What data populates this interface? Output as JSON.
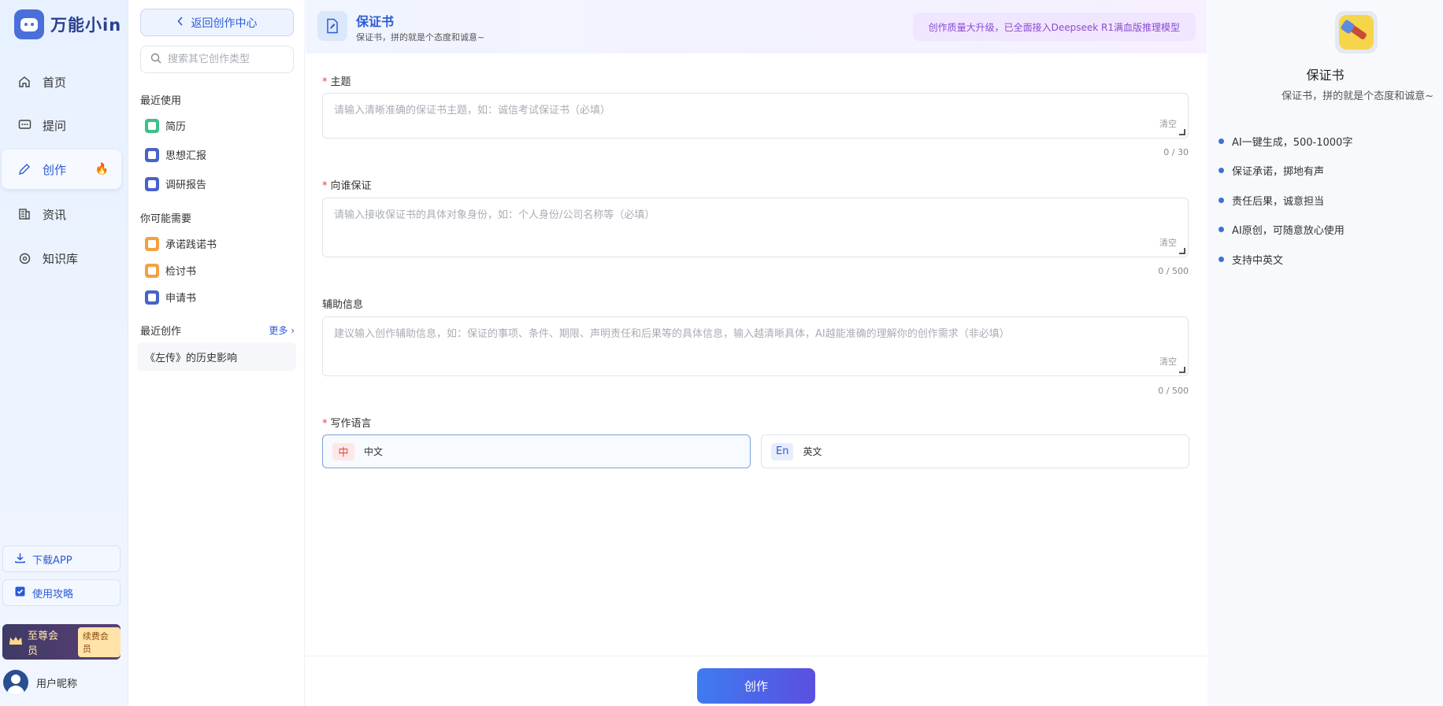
{
  "nav": {
    "brand": "万能小in",
    "items": [
      {
        "label": "首页",
        "icon": "home-icon"
      },
      {
        "label": "提问",
        "icon": "chat-icon"
      },
      {
        "label": "创作",
        "icon": "pen-icon",
        "badge": "fire-icon"
      },
      {
        "label": "资讯",
        "icon": "news-icon"
      },
      {
        "label": "知识库",
        "icon": "brain-icon"
      }
    ],
    "download": "下载APP",
    "guide": "使用攻略",
    "vip_label": "至尊会员",
    "vip_action": "续费会员",
    "user_name": "用户昵称"
  },
  "panel": {
    "back": "返回创作中心",
    "search_placeholder": "搜索其它创作类型",
    "recent_used_title": "最近使用",
    "recent_used": [
      "简历",
      "思想汇报",
      "调研报告"
    ],
    "maybe_title": "你可能需要",
    "maybe": [
      "承诺践诺书",
      "检讨书",
      "申请书"
    ],
    "recent_created_title": "最近创作",
    "more": "更多",
    "recent_created": [
      "《左传》的历史影响"
    ]
  },
  "header": {
    "title": "保证书",
    "subtitle": "保证书，拼的就是个态度和诚意~",
    "promo": "创作质量大升级，已全面接入Deepseek R1满血版推理模型"
  },
  "form": {
    "topic": {
      "label": "主题",
      "placeholder": "请输入清晰准确的保证书主题，如：诚信考试保证书（必填）",
      "clear": "清空",
      "count": "0 / 30"
    },
    "to_whom": {
      "label": "向谁保证",
      "placeholder": "请输入接收保证书的具体对象身份，如：个人身份/公司名称等（必填）",
      "clear": "清空",
      "count": "0 / 500"
    },
    "extra": {
      "label": "辅助信息",
      "placeholder": "建议输入创作辅助信息，如：保证的事项、条件、期限、声明责任和后果等的具体信息，输入越清晰具体，AI越能准确的理解你的创作需求（非必填）",
      "clear": "清空",
      "count": "0 / 500"
    },
    "language": {
      "label": "写作语言",
      "options": [
        {
          "tag": "中",
          "label": "中文",
          "selected": true
        },
        {
          "tag": "En",
          "label": "英文",
          "selected": false
        }
      ]
    },
    "submit": "创作"
  },
  "right": {
    "title": "保证书",
    "subtitle": "保证书，拼的就是个态度和诚意~",
    "features": [
      "AI一键生成，500-1000字",
      "保证承诺，掷地有声",
      "责任后果，诚意担当",
      "AI原创，可随意放心使用",
      "支持中英文"
    ]
  }
}
